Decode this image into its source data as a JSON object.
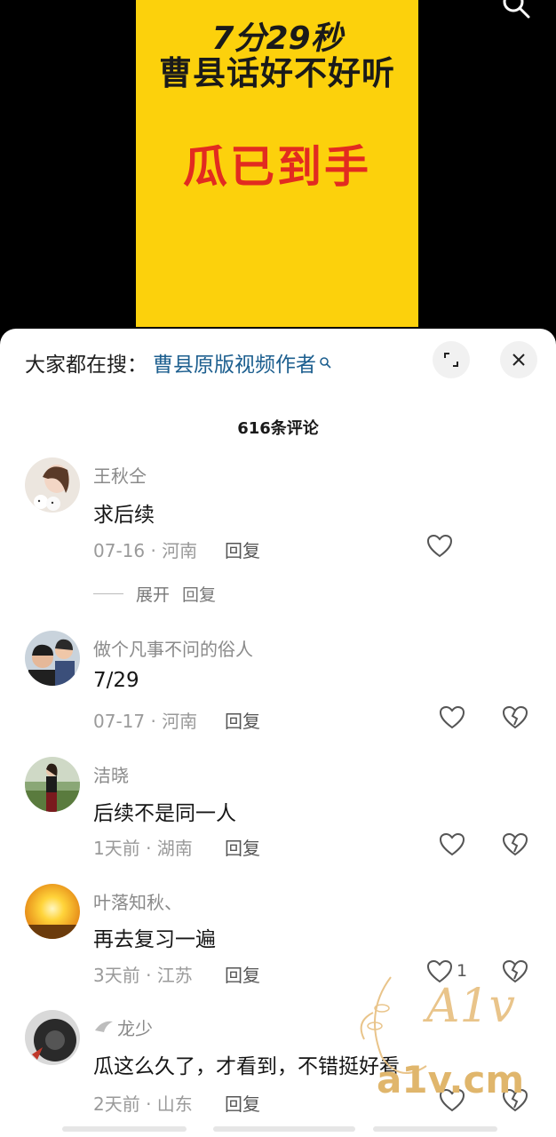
{
  "video": {
    "line1": "7分29秒",
    "line2": "曹县话好不好听",
    "line3": "瓜已到手",
    "search_icon": "search-icon"
  },
  "search_bar": {
    "label": "大家都在搜：",
    "keyword": "曹县原版视频作者",
    "expand_icon": "expand-icon",
    "close_icon": "close-icon"
  },
  "comment_count": "616条评论",
  "comments": [
    {
      "name": "王秋仝",
      "text": "求后续",
      "meta": "07-16 · 河南",
      "reply": "回复",
      "likes": ""
    },
    {
      "name": "做个凡事不问的俗人",
      "text": "7/29",
      "meta": "07-17 · 河南",
      "reply": "回复",
      "likes": ""
    },
    {
      "name": "洁晓",
      "text": "后续不是同一人",
      "meta": "1天前 · 湖南",
      "reply": "回复",
      "likes": ""
    },
    {
      "name": "叶落知秋、",
      "text": "再去复习一遍",
      "meta": "3天前 · 江苏",
      "reply": "回复",
      "likes": "1"
    },
    {
      "name": "龙少",
      "text": "瓜这么久了，才看到，不错挺好看",
      "meta": "2天前 · 山东",
      "reply": "回复",
      "likes": ""
    }
  ],
  "expand_replies": {
    "label": "展开",
    "reply_label": "回复"
  },
  "watermark": {
    "text": "a1v.cm",
    "logo": "A1v"
  },
  "colors": {
    "poster_yellow": "#fcd10c",
    "poster_red": "#e22b20",
    "keyword_blue": "#1d5f8f"
  }
}
